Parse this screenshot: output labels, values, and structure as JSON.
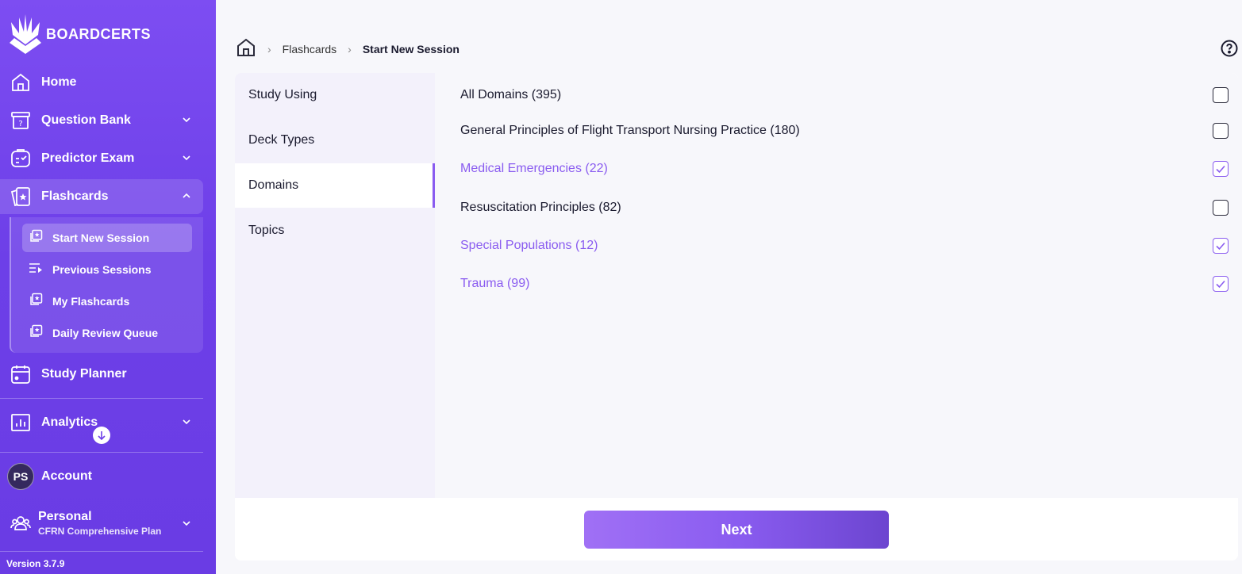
{
  "app": {
    "brand": "BOARDCERTS",
    "version": "Version 3.7.9"
  },
  "sidebar": {
    "items": [
      {
        "label": "Home",
        "icon": "home-icon"
      },
      {
        "label": "Question Bank",
        "icon": "question-box-icon"
      },
      {
        "label": "Predictor Exam",
        "icon": "clipboard-check-icon"
      },
      {
        "label": "Flashcards",
        "icon": "flashcard-star-icon"
      },
      {
        "label": "Study Planner",
        "icon": "calendar-icon"
      },
      {
        "label": "Analytics",
        "icon": "bar-chart-icon"
      }
    ],
    "flashcards_sub": [
      {
        "label": "Start New Session",
        "icon": "cards-star-icon"
      },
      {
        "label": "Previous Sessions",
        "icon": "list-play-icon"
      },
      {
        "label": "My Flashcards",
        "icon": "cards-star-icon"
      },
      {
        "label": "Daily Review Queue",
        "icon": "cards-star-icon"
      }
    ],
    "account": {
      "initials": "PS",
      "label": "Account"
    },
    "plan": {
      "label": "Personal",
      "sub": "CFRN Comprehensive Plan"
    }
  },
  "breadcrumb": {
    "parent": "Flashcards",
    "current": "Start New Session"
  },
  "tabs": [
    "Study Using",
    "Deck Types",
    "Domains",
    "Topics"
  ],
  "active_tab": "Domains",
  "domains": [
    {
      "label": "All Domains (395)",
      "checked": false
    },
    {
      "label": "General Principles of Flight Transport Nursing Practice (180)",
      "checked": false
    },
    {
      "label": "Medical Emergencies (22)",
      "checked": true
    },
    {
      "label": "Resuscitation Principles (82)",
      "checked": false
    },
    {
      "label": "Special Populations (12)",
      "checked": true
    },
    {
      "label": "Trauma (99)",
      "checked": true
    }
  ],
  "next_label": "Next",
  "colors": {
    "accent": "#8a5cf0",
    "sidebar": "#7048e8"
  }
}
